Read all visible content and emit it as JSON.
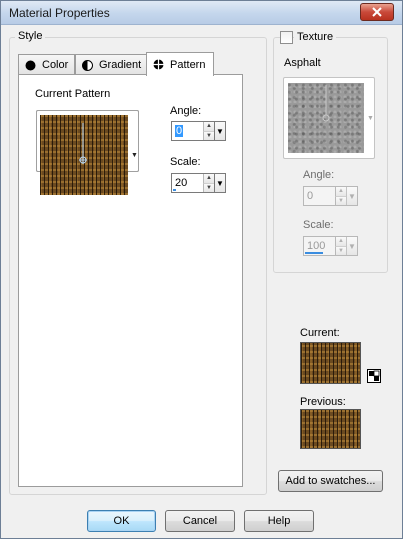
{
  "window": {
    "title": "Material Properties"
  },
  "style_group": {
    "title": "Style"
  },
  "tabs": [
    {
      "label": "Color",
      "icon": "filled-circle-icon"
    },
    {
      "label": "Gradient",
      "icon": "half-circle-icon"
    },
    {
      "label": "Pattern",
      "icon": "pattern-icon",
      "active": true
    }
  ],
  "pattern_panel": {
    "current_pattern_label": "Current Pattern",
    "angle_label": "Angle:",
    "angle_value": "0",
    "scale_label": "Scale:",
    "scale_value": "20"
  },
  "texture": {
    "checkbox_label": "Texture",
    "checked": false,
    "name": "Asphalt",
    "angle_label": "Angle:",
    "angle_value": "0",
    "scale_label": "Scale:",
    "scale_value": "100"
  },
  "swatches": {
    "current_label": "Current:",
    "previous_label": "Previous:",
    "add_button": "Add to swatches..."
  },
  "buttons": {
    "ok": "OK",
    "cancel": "Cancel",
    "help": "Help"
  },
  "colors": {
    "title_close": "#c9493a",
    "spin_highlight": "#3399ff",
    "pattern_brown": "#6b4a20"
  }
}
